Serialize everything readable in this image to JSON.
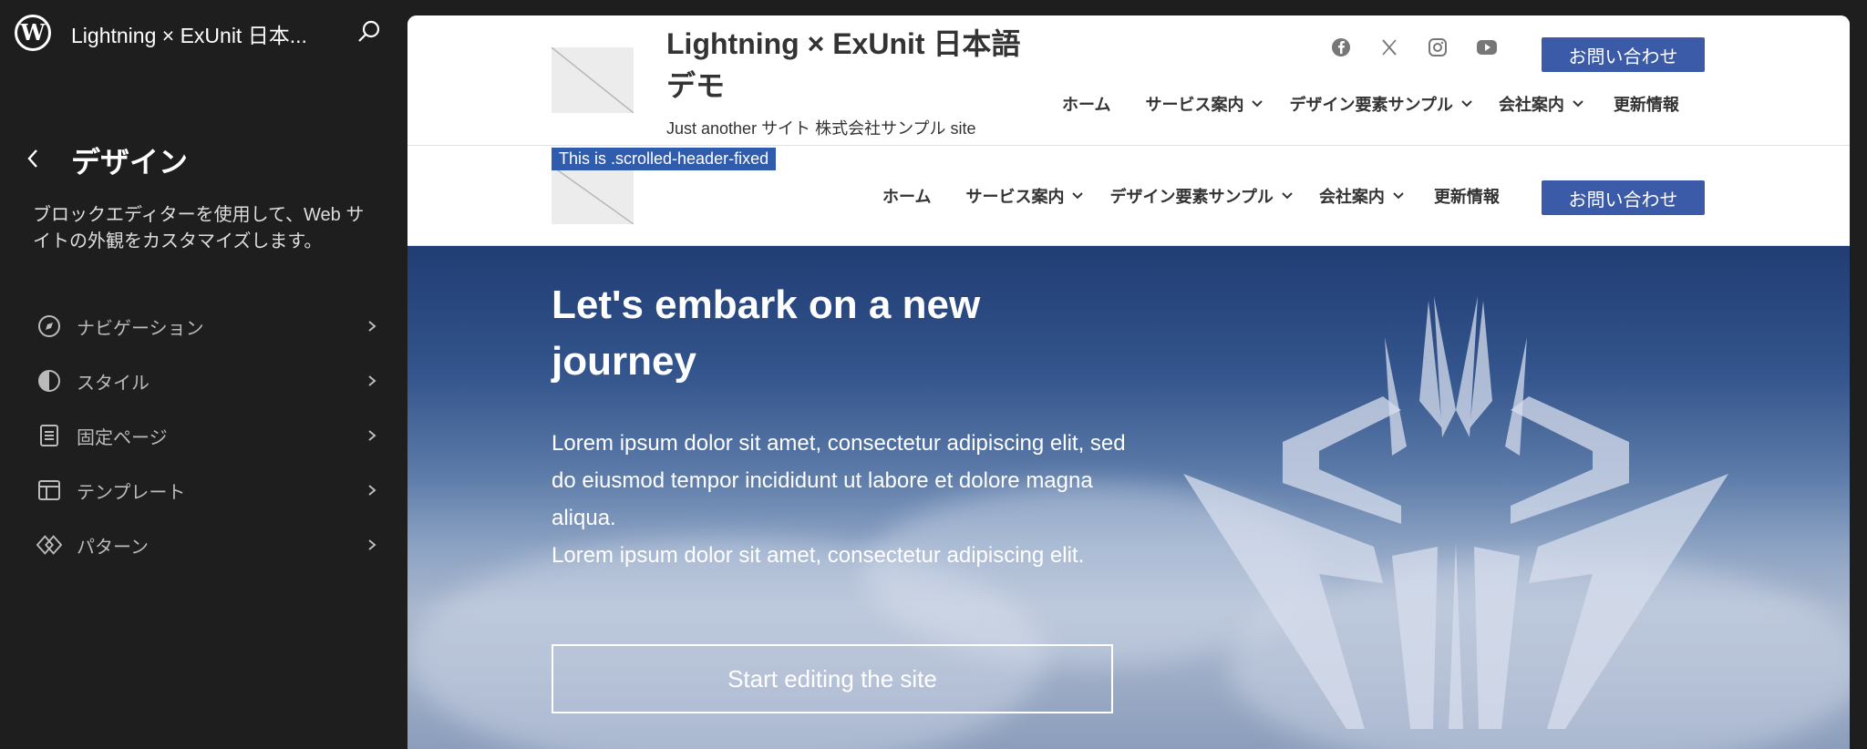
{
  "sidebar": {
    "site_title": "Lightning × ExUnit 日本...",
    "section_title": "デザイン",
    "description": "ブロックエディターを使用して、Web サイトの外観をカスタマイズします。",
    "items": [
      {
        "label": "ナビゲーション",
        "icon": "compass-icon"
      },
      {
        "label": "スタイル",
        "icon": "half-circle-icon"
      },
      {
        "label": "固定ページ",
        "icon": "page-icon"
      },
      {
        "label": "テンプレート",
        "icon": "layout-icon"
      },
      {
        "label": "パターン",
        "icon": "diamond-icon"
      }
    ]
  },
  "preview": {
    "header": {
      "site_title": "Lightning × ExUnit 日本語デモ",
      "tagline": "Just another サイト 株式会社サンプル site",
      "social": [
        "facebook-icon",
        "x-icon",
        "instagram-icon",
        "youtube-icon"
      ],
      "contact_label": "お問い合わせ",
      "menu": [
        "ホーム",
        "サービス案内",
        "デザイン要素サンプル",
        "会社案内",
        "更新情報"
      ]
    },
    "fixed_header": {
      "label": "This is .scrolled-header-fixed",
      "menu": [
        "ホーム",
        "サービス案内",
        "デザイン要素サンプル",
        "会社案内",
        "更新情報"
      ],
      "contact_label": "お問い合わせ"
    },
    "hero": {
      "title": "Let's embark on a new journey",
      "text1": "Lorem ipsum dolor sit amet, consectetur adipiscing elit, sed do eiusmod tempor incididunt ut labore et dolore magna aliqua.",
      "text2": "Lorem ipsum dolor sit amet, consectetur adipiscing elit.",
      "button_label": "Start editing the site"
    }
  },
  "colors": {
    "sidebar_bg": "#1e1e1e",
    "accent": "#3b5aa8",
    "label_bg": "#2f5cad"
  }
}
